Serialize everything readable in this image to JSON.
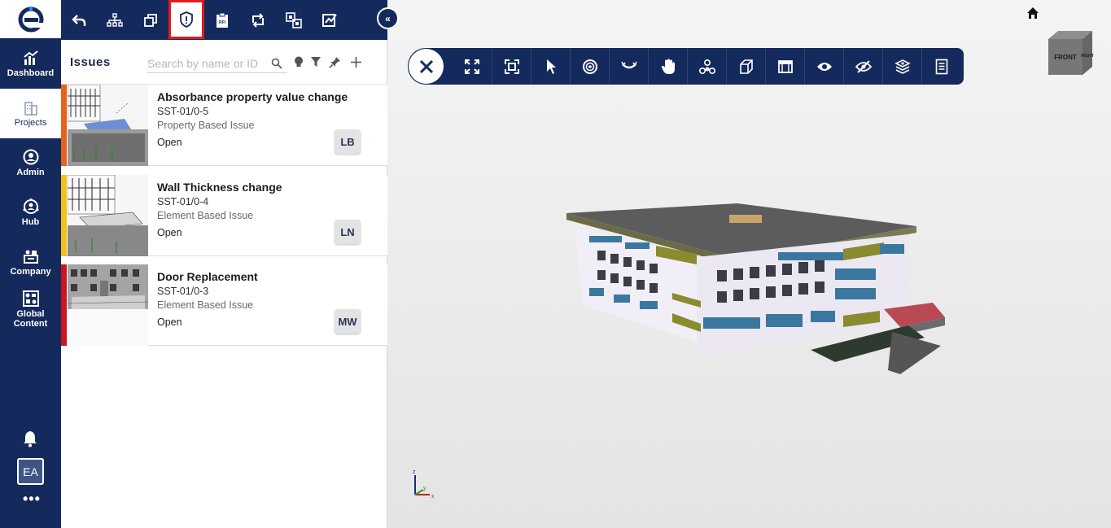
{
  "sidenav": {
    "items": [
      {
        "label": "Dashboard",
        "icon": "chart-icon"
      },
      {
        "label": "Projects",
        "icon": "buildings-icon",
        "active": true
      },
      {
        "label": "Admin",
        "icon": "admin-user-icon"
      },
      {
        "label": "Hub",
        "icon": "hub-icon"
      },
      {
        "label": "Company",
        "icon": "company-icon"
      },
      {
        "label": "Global\nContent",
        "icon": "global-content-icon"
      }
    ],
    "avatar_initials": "EA",
    "more_label": "•••"
  },
  "panel_toolbar": {
    "buttons": [
      "undo-arrow-icon",
      "hierarchy-icon",
      "copy-icon",
      "issue-shield-icon",
      "rfi-clipboard-icon",
      "sync-icon",
      "compare-icon",
      "measure-icon"
    ],
    "selected": "issue-shield-icon",
    "collapse_label": "«"
  },
  "issues": {
    "title": "Issues",
    "search_placeholder": "Search by name or ID",
    "items": [
      {
        "title": "Absorbance property value change",
        "code": "SST-01/0-5",
        "type": "Property Based Issue",
        "status": "Open",
        "user": "LB",
        "color": "#e8611a"
      },
      {
        "title": "Wall Thickness change",
        "code": "SST-01/0-4",
        "type": "Element Based Issue",
        "status": "Open",
        "user": "LN",
        "color": "#f2c21b"
      },
      {
        "title": "Door Replacement",
        "code": "SST-01/0-3",
        "type": "Element Based Issue",
        "status": "Open",
        "user": "MW",
        "color": "#c8151f"
      }
    ]
  },
  "viewer": {
    "toolbar_buttons": [
      "fullscreen-icon",
      "fit-view-icon",
      "select-pointer-icon",
      "orbit-icon",
      "look-around-icon",
      "pan-hand-icon",
      "model-tree-icon",
      "section-box-icon",
      "section-plane-icon",
      "show-eye-icon",
      "hide-eye-icon",
      "layers-icon",
      "properties-sheet-icon"
    ],
    "viewcube": {
      "front": "FRONT",
      "right": "RIGHT"
    },
    "axis": {
      "x": "x",
      "y": "y",
      "z": "z"
    }
  }
}
